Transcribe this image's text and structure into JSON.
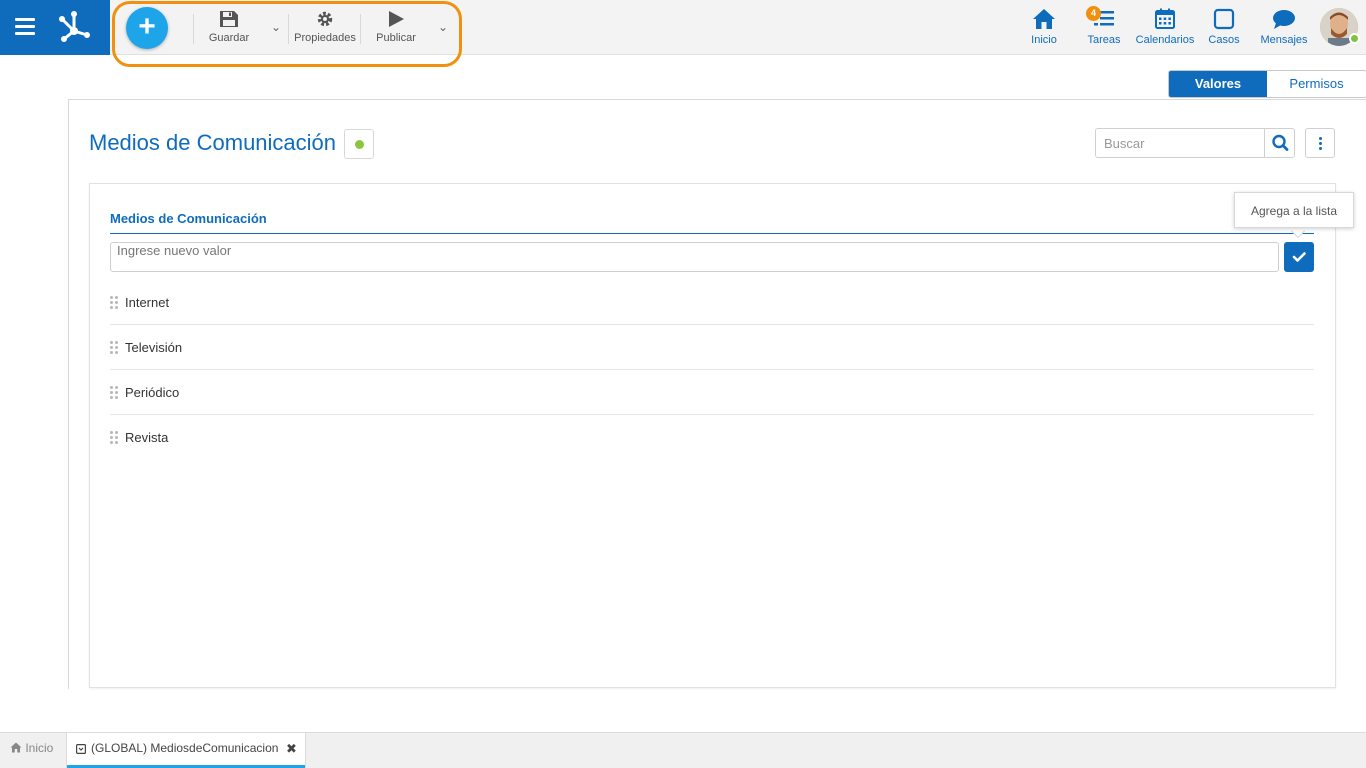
{
  "toolbar": {
    "save_label": "Guardar",
    "properties_label": "Propiedades",
    "publish_label": "Publicar"
  },
  "nav": {
    "home_label": "Inicio",
    "tasks_label": "Tareas",
    "tasks_badge": "4",
    "calendars_label": "Calendarios",
    "cases_label": "Casos",
    "messages_label": "Mensajes"
  },
  "tabs": {
    "values_label": "Valores",
    "permissions_label": "Permisos"
  },
  "page": {
    "title": "Medios de Comunicación",
    "search_placeholder": "Buscar"
  },
  "list": {
    "header": "Medios de Comunicación",
    "new_value_placeholder": "Ingrese nuevo valor",
    "add_tooltip": "Agrega a la lista",
    "items": [
      "Internet",
      "Televisión",
      "Periódico",
      "Revista"
    ]
  },
  "bottom_tabs": {
    "home_label": "Inicio",
    "active_label": "(GLOBAL) MediosdeComunicacion"
  },
  "colors": {
    "primary": "#0f6cbd",
    "accent": "#1ea4e9",
    "highlight": "#f0900e",
    "status_ok": "#8cc63f"
  }
}
